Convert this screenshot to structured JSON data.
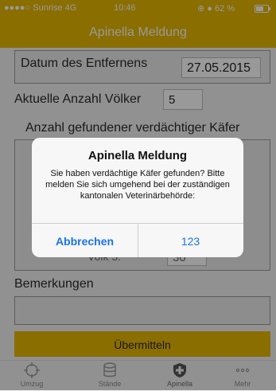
{
  "status_bar": {
    "carrier": "●●●●○ Sunrise  4G",
    "time": "10:46",
    "right": "⊕ ● 62 %"
  },
  "nav": {
    "title": "Apinella Meldung"
  },
  "form": {
    "date_label": "Datum des Entfernens",
    "date_value": "27.05.2015",
    "count_label": "Aktuelle Anzahl Völker",
    "count_value": "5",
    "beetle_label": "Anzahl gefundener verdächtiger Käfer",
    "volk_label": "Volk 5:",
    "volk_value": "30",
    "remarks_label": "Bemerkungen",
    "remarks_value": "",
    "submit_label": "Übermitteln"
  },
  "tabs": [
    {
      "label": "Umzug",
      "icon": "crosshair-icon"
    },
    {
      "label": "Stände",
      "icon": "database-icon"
    },
    {
      "label": "Apinella",
      "icon": "shield-plus-icon",
      "active": true
    },
    {
      "label": "Mehr",
      "icon": "more-icon"
    }
  ],
  "alert": {
    "title": "Apinella Meldung",
    "message": "Sie haben verdächtige Käfer gefunden? Bitte melden Sie sich umgehend bei der zuständigen kantonalen Veterinärbehörde:",
    "cancel_label": "Abbrechen",
    "ok_label": "123"
  },
  "colors": {
    "accent": "#e6b800",
    "link": "#1a73e8"
  }
}
